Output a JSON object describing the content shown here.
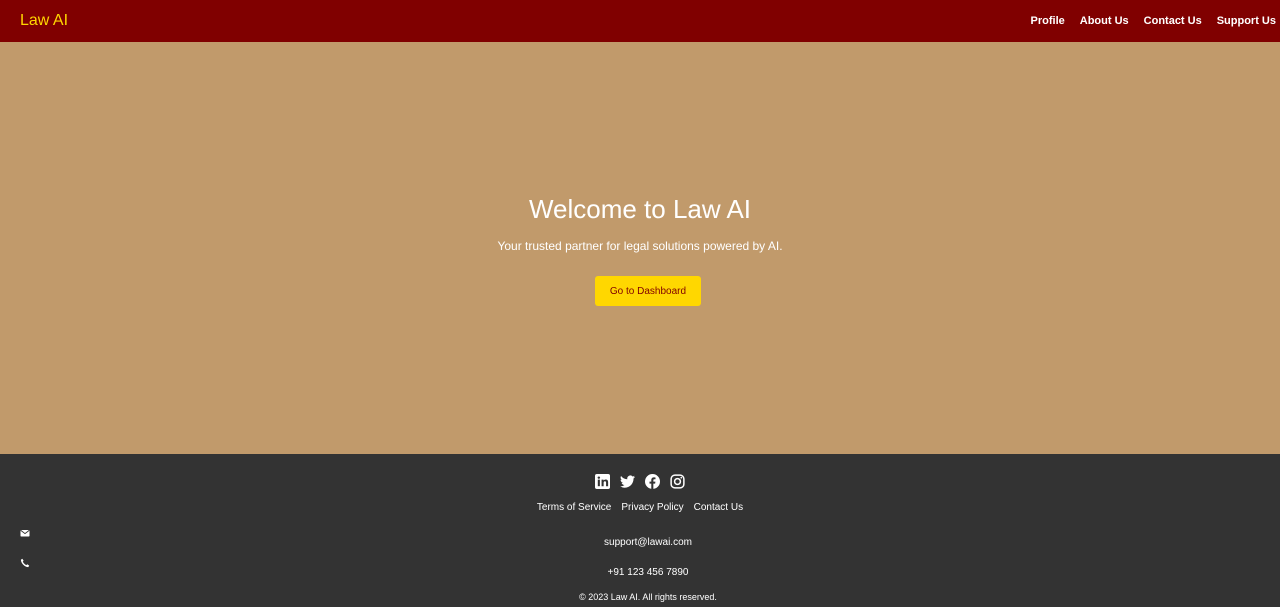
{
  "header": {
    "brand": "Law AI",
    "nav": [
      {
        "label": "Profile"
      },
      {
        "label": "About Us"
      },
      {
        "label": "Contact Us"
      },
      {
        "label": "Support Us"
      }
    ]
  },
  "hero": {
    "title": "Welcome to Law AI",
    "subtitle": "Your trusted partner for legal solutions powered by AI.",
    "button_label": "Go to Dashboard"
  },
  "footer": {
    "social_icons": [
      "linkedin-icon",
      "twitter-icon",
      "facebook-icon",
      "instagram-icon"
    ],
    "links": [
      {
        "label": "Terms of Service"
      },
      {
        "label": "Privacy Policy"
      },
      {
        "label": "Contact Us"
      }
    ],
    "contact_icons": [
      "envelope-icon",
      "phone-icon"
    ],
    "email": "support@lawai.com",
    "phone": "+91 123 456 7890",
    "copyright": "© 2023 Law AI. All rights reserved."
  },
  "colors": {
    "header_bg": "#800000",
    "brand": "#FFD700",
    "hero_bg": "#C19A6B",
    "button_bg": "#FFD700",
    "button_text": "#800000",
    "footer_bg": "#333333"
  }
}
